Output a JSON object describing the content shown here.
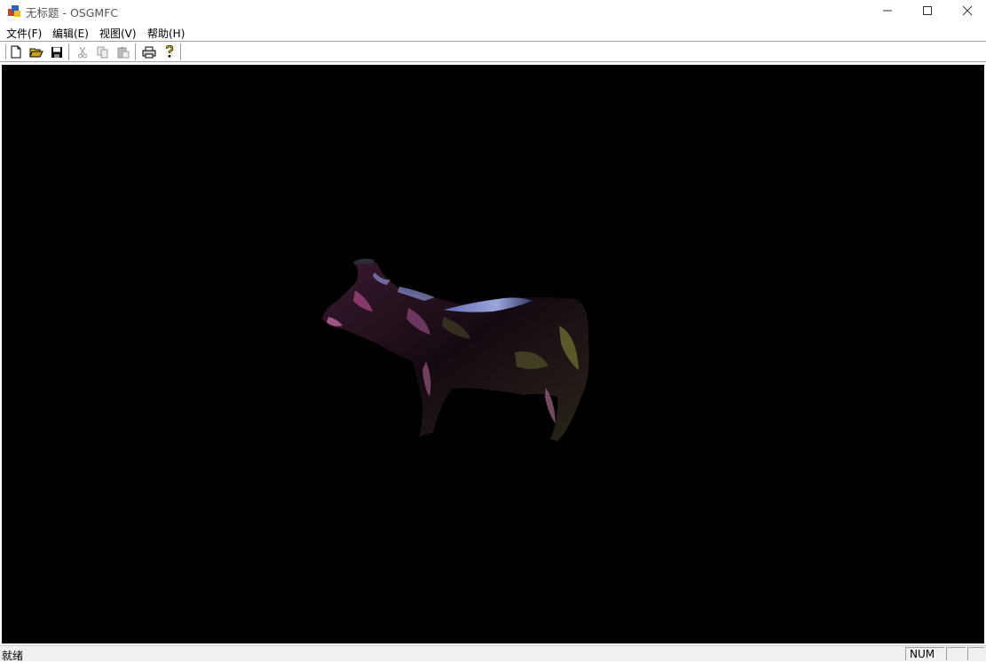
{
  "window": {
    "title": "无标题 - OSGMFC",
    "app_icon": "mfc-app-icon",
    "controls": [
      "minimize-icon",
      "maximize-icon",
      "close-icon"
    ]
  },
  "menu": [
    {
      "label": "文件(F)"
    },
    {
      "label": "编辑(E)"
    },
    {
      "label": "视图(V)"
    },
    {
      "label": "帮助(H)"
    }
  ],
  "toolbar": {
    "buttons": [
      "new-file-icon",
      "open-folder-icon",
      "save-icon",
      "cut-icon",
      "copy-icon",
      "paste-icon",
      "print-icon",
      "help-icon"
    ]
  },
  "viewport": {
    "background": "#000000",
    "content": "cow-3d-model"
  },
  "status": {
    "text": "就绪",
    "panes": [
      "NUM",
      "",
      ""
    ]
  }
}
